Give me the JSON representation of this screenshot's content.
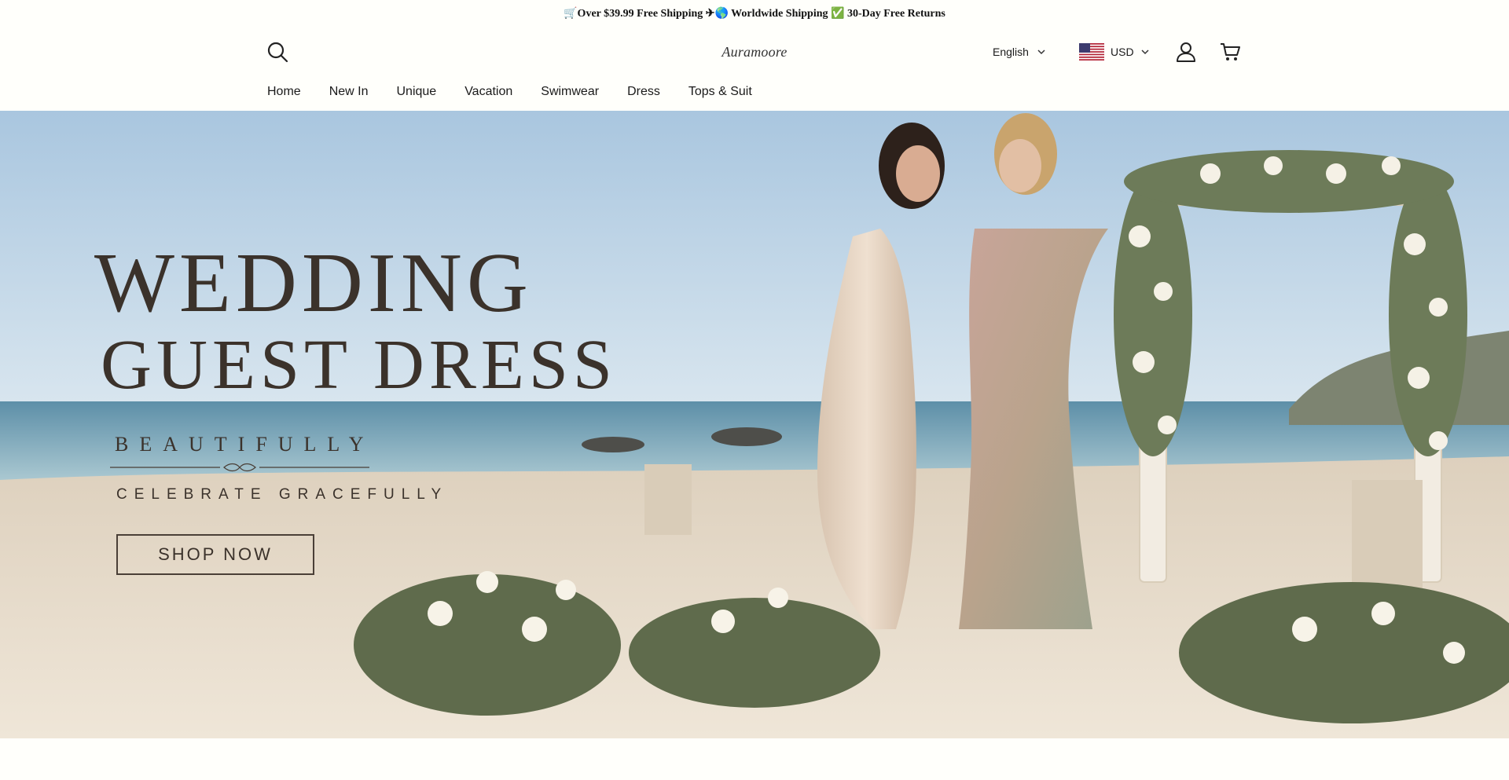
{
  "announcement": {
    "text": "🛒Over $39.99 Free Shipping ✈🌎 Worldwide Shipping ✅ 30-Day Free Returns"
  },
  "header": {
    "logo_text": "Auramoore",
    "language": "English",
    "currency": "USD",
    "icons": {
      "search": "search-icon",
      "account": "user-icon",
      "cart": "cart-icon",
      "language_caret": "chevron-down-icon",
      "currency_caret": "chevron-down-icon",
      "flag": "us-flag-icon"
    }
  },
  "nav": {
    "items": [
      {
        "label": "Home"
      },
      {
        "label": "New In"
      },
      {
        "label": "Unique"
      },
      {
        "label": "Vacation"
      },
      {
        "label": "Swimwear"
      },
      {
        "label": "Dress"
      },
      {
        "label": "Tops & Suit"
      }
    ]
  },
  "hero": {
    "title_line1": "WEDDING",
    "title_line2": "GUEST DRESS",
    "subtitle_line1": "BEAUTIFULLY",
    "subtitle_line2": "CELEBRATE GRACEFULLY",
    "cta_label": "SHOP NOW"
  },
  "colors": {
    "background": "#fffffb",
    "hero_text": "#3b322b",
    "sky": "#bcd3e6",
    "sea": "#7fa9bd",
    "sand": "#e9ddcc"
  }
}
